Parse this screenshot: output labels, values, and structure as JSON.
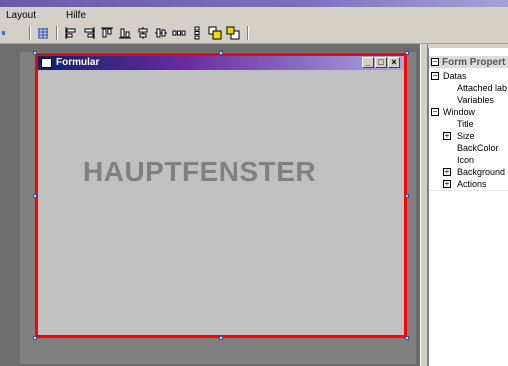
{
  "menu": {
    "items": [
      "Layout",
      "Hilfe"
    ]
  },
  "form": {
    "title": "Formular",
    "content_label": "HAUPTFENSTER",
    "caption_buttons": [
      "_",
      "□",
      "×"
    ]
  },
  "properties": {
    "header": "Form Propert",
    "rows": [
      {
        "label": "Datas",
        "expander": "⊟"
      },
      {
        "label": "Attached lab"
      },
      {
        "label": "Variables"
      },
      {
        "label": "Window",
        "expander": "⊟"
      },
      {
        "label": "Title"
      },
      {
        "label": "Size",
        "expander": "⊞"
      },
      {
        "label": "BackColor"
      },
      {
        "label": "Icon"
      },
      {
        "label": "Background",
        "expander": "⊞"
      },
      {
        "label": "Actions",
        "expander": "⊞"
      }
    ]
  },
  "icons": {
    "toolbar": [
      "grid-icon",
      "align-left-icon",
      "align-right-icon",
      "align-top-icon",
      "align-bottom-icon",
      "center-horizontal-icon",
      "center-vertical-icon",
      "space-horizontal-icon",
      "space-vertical-icon",
      "bring-front-icon",
      "send-back-icon"
    ]
  },
  "colors": {
    "selection_border": "#ff0000",
    "titlebar_start": "#0a246a",
    "canvas": "#6e6e6e"
  }
}
